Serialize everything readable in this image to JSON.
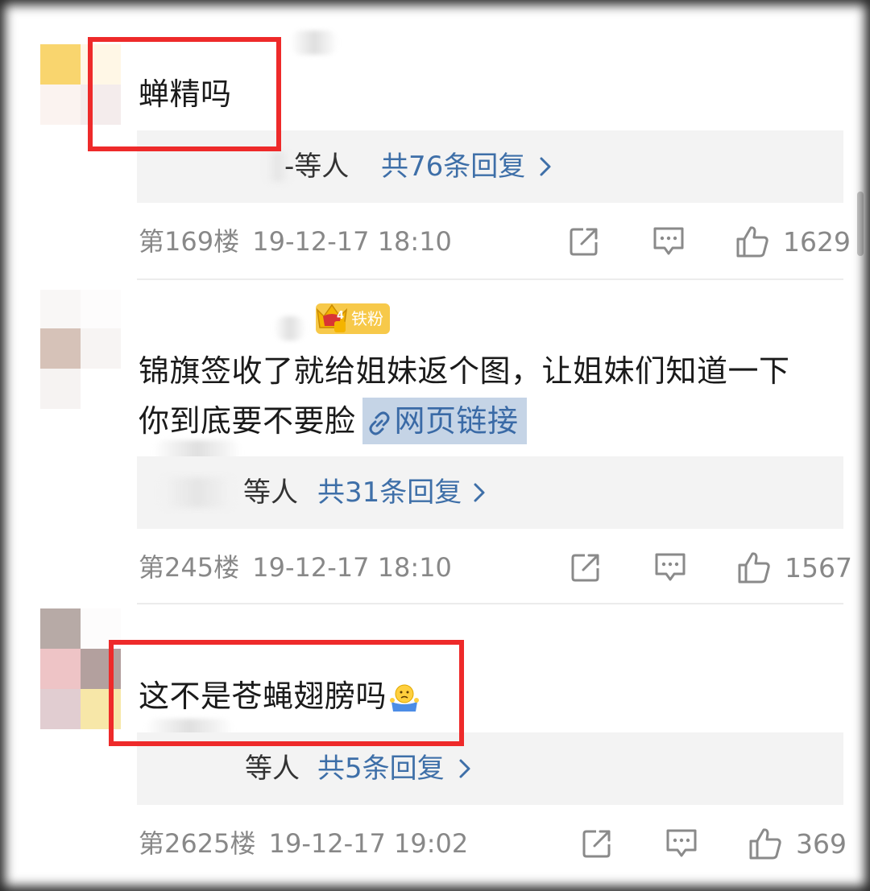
{
  "comments": [
    {
      "text": "蝉精吗",
      "reply_prefix": "-等人",
      "reply_count": "共76条回复",
      "floor": "第169楼",
      "time": "19-12-17 18:10",
      "likes": "1629",
      "highlighted": true
    },
    {
      "badge": "铁粉",
      "badge_level": "4",
      "text_line1": "锦旗签收了就给姐妹返个图，让姐妹们知道一下",
      "text_line2": "你到底要不要脸",
      "link_text": "网页链接",
      "reply_prefix": "等人",
      "reply_count": "共31条回复",
      "floor": "第245楼",
      "time": "19-12-17 18:10",
      "likes": "1567"
    },
    {
      "text": "这不是苍蝇翅膀吗",
      "emoji": "shrug-emoji",
      "reply_prefix": "等人",
      "reply_count": "共5条回复",
      "floor": "第2625楼",
      "time": "19-12-17 19:02",
      "likes": "369",
      "highlighted": true
    }
  ],
  "icons": {
    "share": "share-icon",
    "comment": "comment-icon",
    "like": "thumbs-up-icon",
    "chevron": "chevron-right-icon",
    "link": "link-icon"
  },
  "colors": {
    "highlight_box": "#ee2a2a",
    "link_blue": "#3e6fa8",
    "meta_gray": "#888888",
    "badge_gold": "#f7c94a"
  }
}
